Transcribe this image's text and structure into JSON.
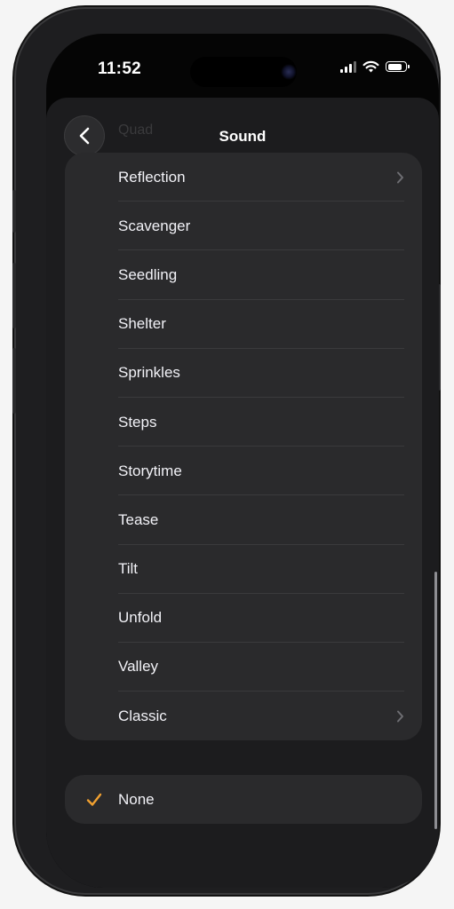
{
  "status_bar": {
    "time": "11:52",
    "battery_level": 0.85,
    "signal_bars_active": 3
  },
  "header": {
    "title": "Sound",
    "back_icon": "chevron-left-icon",
    "partially_hidden_item": "Quad"
  },
  "sounds": {
    "items": [
      {
        "label": "Reflection",
        "has_chevron": true
      },
      {
        "label": "Scavenger",
        "has_chevron": false
      },
      {
        "label": "Seedling",
        "has_chevron": false
      },
      {
        "label": "Shelter",
        "has_chevron": false
      },
      {
        "label": "Sprinkles",
        "has_chevron": false
      },
      {
        "label": "Steps",
        "has_chevron": false
      },
      {
        "label": "Storytime",
        "has_chevron": false
      },
      {
        "label": "Tease",
        "has_chevron": false
      },
      {
        "label": "Tilt",
        "has_chevron": false
      },
      {
        "label": "Unfold",
        "has_chevron": false
      },
      {
        "label": "Valley",
        "has_chevron": false
      },
      {
        "label": "Classic",
        "has_chevron": true
      }
    ]
  },
  "none_option": {
    "label": "None",
    "selected": true,
    "check_icon": "checkmark-icon"
  },
  "colors": {
    "accent": "#f0a030",
    "card": "#2a2a2c",
    "sheet": "#1c1c1e",
    "text": "#f2f2f7"
  }
}
